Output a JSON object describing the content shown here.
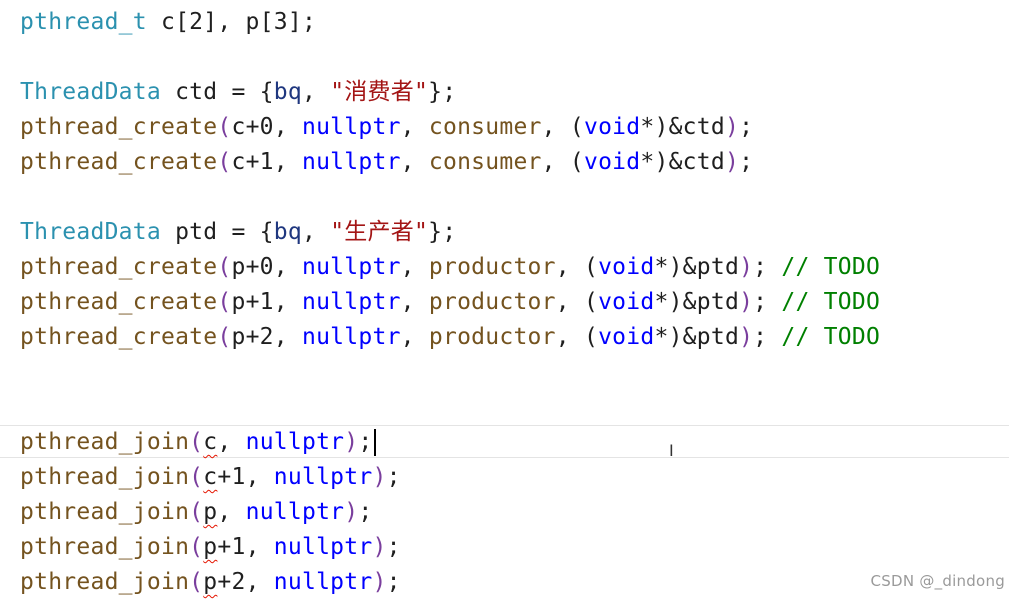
{
  "code": {
    "line1": {
      "type": "pthread_t",
      "rest": " c[2], p[3];"
    },
    "line2": {
      "type": "ThreadData",
      "var": " ctd = ",
      "open": "{",
      "bq": "bq",
      "comma": ", ",
      "str": "\"消费者\"",
      "close": "}",
      "end": ";"
    },
    "line3": {
      "fn": "pthread_create",
      "open": "(",
      "arg1": "c+0",
      "sep1": ", ",
      "arg2": "nullptr",
      "sep2": ", ",
      "arg3": "consumer",
      "sep3": ", ",
      "cast_open": "(",
      "cast_kw": "void",
      "cast_rest": "*",
      "cast_close": ")",
      "arg4": "&ctd",
      "close": ")",
      "end": ";"
    },
    "line4": {
      "fn": "pthread_create",
      "open": "(",
      "arg1": "c+1",
      "sep1": ", ",
      "arg2": "nullptr",
      "sep2": ", ",
      "arg3": "consumer",
      "sep3": ", ",
      "cast_open": "(",
      "cast_kw": "void",
      "cast_rest": "*",
      "cast_close": ")",
      "arg4": "&ctd",
      "close": ")",
      "end": ";"
    },
    "line5": {
      "type": "ThreadData",
      "var": " ptd = ",
      "open": "{",
      "bq": "bq",
      "comma": ", ",
      "str": "\"生产者\"",
      "close": "}",
      "end": ";"
    },
    "line6": {
      "fn": "pthread_create",
      "open": "(",
      "arg1": "p+0",
      "sep1": ", ",
      "arg2": "nullptr",
      "sep2": ", ",
      "arg3": "productor",
      "sep3": ", ",
      "cast_open": "(",
      "cast_kw": "void",
      "cast_rest": "*",
      "cast_close": ")",
      "arg4": "&ptd",
      "close": ")",
      "end": "; ",
      "comment": "// TODO"
    },
    "line7": {
      "fn": "pthread_create",
      "open": "(",
      "arg1": "p+1",
      "sep1": ", ",
      "arg2": "nullptr",
      "sep2": ", ",
      "arg3": "productor",
      "sep3": ", ",
      "cast_open": "(",
      "cast_kw": "void",
      "cast_rest": "*",
      "cast_close": ")",
      "arg4": "&ptd",
      "close": ")",
      "end": "; ",
      "comment": "// TODO"
    },
    "line8": {
      "fn": "pthread_create",
      "open": "(",
      "arg1": "p+2",
      "sep1": ", ",
      "arg2": "nullptr",
      "sep2": ", ",
      "arg3": "productor",
      "sep3": ", ",
      "cast_open": "(",
      "cast_kw": "void",
      "cast_rest": "*",
      "cast_close": ")",
      "arg4": "&ptd",
      "close": ")",
      "end": "; ",
      "comment": "// TODO"
    },
    "line9": {
      "fn": "pthread_join",
      "open": "(",
      "var": "c",
      "suffix": "",
      "sep": ", ",
      "arg2": "nullptr",
      "close": ")",
      "end": ";"
    },
    "line10": {
      "fn": "pthread_join",
      "open": "(",
      "var": "c",
      "suffix": "+1",
      "sep": ", ",
      "arg2": "nullptr",
      "close": ")",
      "end": ";"
    },
    "line11": {
      "fn": "pthread_join",
      "open": "(",
      "var": "p",
      "suffix": "",
      "sep": ", ",
      "arg2": "nullptr",
      "close": ")",
      "end": ";"
    },
    "line12": {
      "fn": "pthread_join",
      "open": "(",
      "var": "p",
      "suffix": "+1",
      "sep": ", ",
      "arg2": "nullptr",
      "close": ")",
      "end": ";"
    },
    "line13": {
      "fn": "pthread_join",
      "open": "(",
      "var": "p",
      "suffix": "+2",
      "sep": ", ",
      "arg2": "nullptr",
      "close": ")",
      "end": ";"
    }
  },
  "watermark": "CSDN @_dindong",
  "cursor_icon": "i-beam-cursor-icon",
  "colors": {
    "function": "#74531f",
    "type": "#2b91af",
    "keyword": "#0000ff",
    "string": "#a31515",
    "comment": "#008000",
    "identifier": "#1f377f",
    "error_squiggle": "#e51400"
  }
}
